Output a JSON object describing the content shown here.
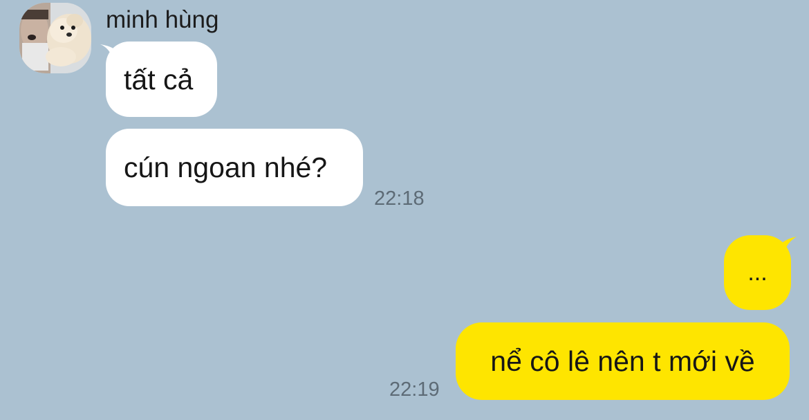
{
  "conversation": {
    "incoming": {
      "sender_name": "minh hùng",
      "avatar_icon": "profile-photo-dog",
      "messages": [
        {
          "text": "tất cả"
        },
        {
          "text": "cún ngoan nhé?"
        }
      ],
      "time": "22:18"
    },
    "outgoing": {
      "messages": [
        {
          "text": "..."
        },
        {
          "text": "nể cô lê nên t mới về"
        }
      ],
      "time": "22:19"
    }
  },
  "colors": {
    "background": "#abc1d1",
    "incoming_bubble": "#ffffff",
    "outgoing_bubble": "#fee500",
    "timestamp": "#5d6b76"
  }
}
